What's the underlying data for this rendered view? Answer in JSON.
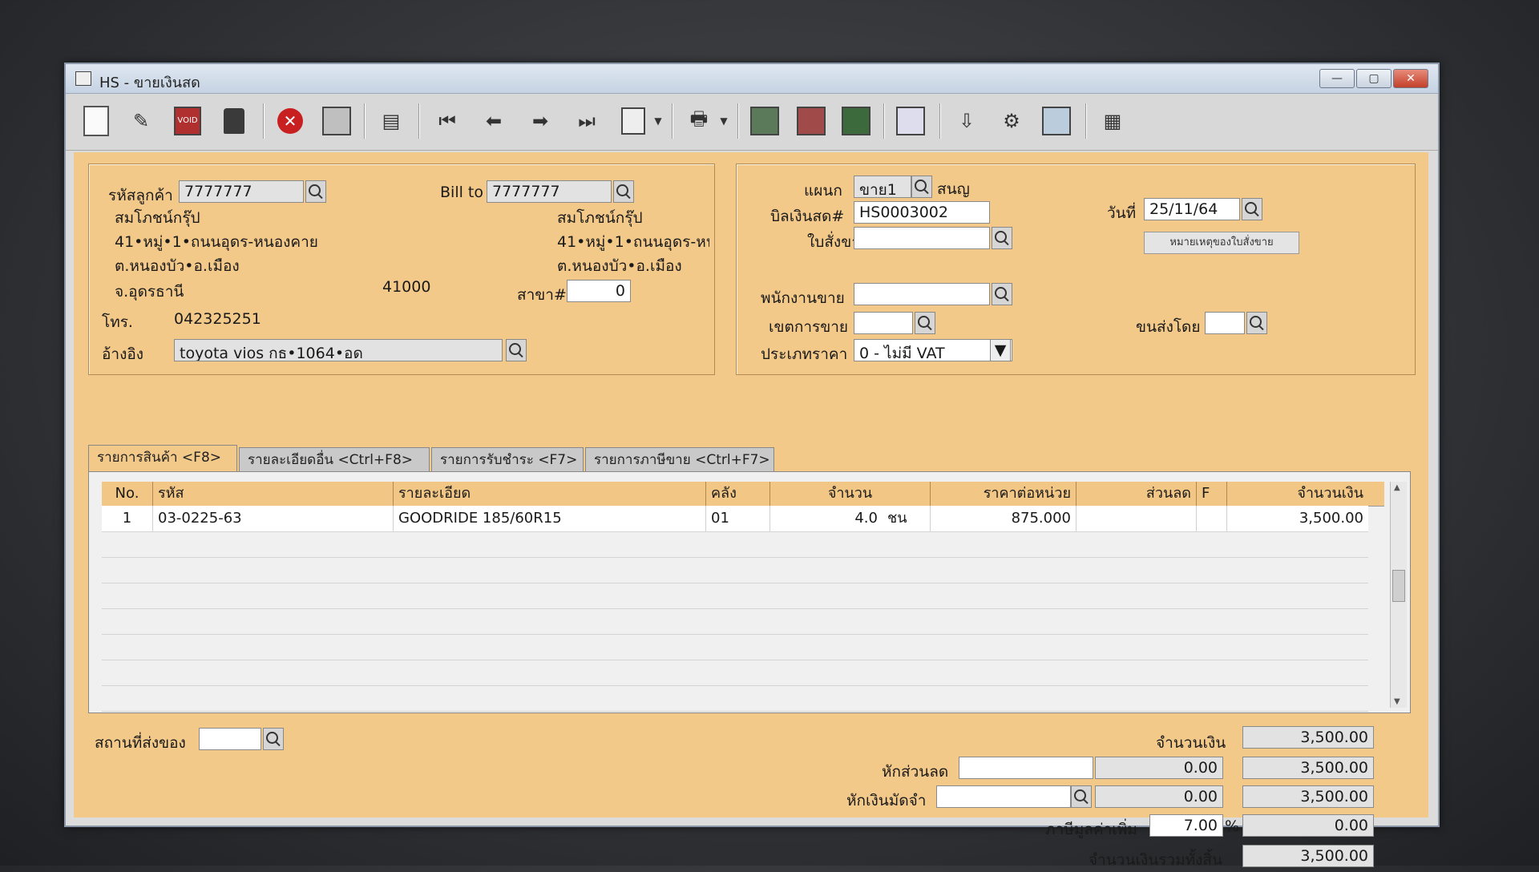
{
  "window": {
    "title": "HS - ขายเงินสด"
  },
  "customer": {
    "code_label": "รหัสลูกค้า",
    "code": "7777777",
    "bill_to_label": "Bill to",
    "bill_to": "7777777",
    "name": "สมโภชน์กรุ๊ป",
    "address1": "41•หมู่•1•ถนนอุดร-หนองคาย",
    "address2": "ต.หนองบัว•อ.เมือง",
    "province": "จ.อุดรธานี",
    "postcode": "41000",
    "billto_name": "สมโภชน์กรุ๊ป",
    "billto_address1": "41•หมู่•1•ถนนอุดร-หนเ",
    "billto_address2": "ต.หนองบัว•อ.เมือง",
    "branch_label": "สาขา#",
    "branch": "0",
    "phone_label": "โทร.",
    "phone": "042325251",
    "reference_label": "อ้างอิง",
    "reference": "toyota vios กธ•1064•อด"
  },
  "doc": {
    "dept_label": "แผนก",
    "dept": "ขาย1",
    "dept_name": "สนญ",
    "bill_label": "บิลเงินสด#",
    "bill": "HS0003002",
    "order_label": "ใบสั่งขาย",
    "order": "",
    "date_label": "วันที่",
    "date": "25/11/64",
    "note_button": "หมายเหตุของใบสั่งขาย",
    "salesman_label": "พนักงานขาย",
    "salesman": "",
    "area_label": "เขตการขาย",
    "area": "",
    "ship_by_label": "ขนส่งโดย",
    "ship_by": "",
    "price_type_label": "ประเภทราคา",
    "price_type": "0 - ไม่มี VAT"
  },
  "tabs": [
    {
      "label": "รายการสินค้า <F8>"
    },
    {
      "label": "รายละเอียดอื่น <Ctrl+F8>"
    },
    {
      "label": "รายการรับชำระ <F7>"
    },
    {
      "label": "รายการภาษีขาย <Ctrl+F7>"
    }
  ],
  "grid": {
    "headers": {
      "no": "No.",
      "code": "รหัส",
      "desc": "รายละเอียด",
      "wh": "คลัง",
      "qty": "จำนวน",
      "price": "ราคาต่อหน่วย",
      "disc": "ส่วนลด",
      "f": "F",
      "amount": "จำนวนเงิน"
    },
    "rows": [
      {
        "no": "1",
        "code": "03-0225-63",
        "desc": "GOODRIDE 185/60R15",
        "wh": "01",
        "qty": "4.0",
        "unit": "ชน",
        "price": "875.000",
        "disc": "",
        "f": "",
        "amount": "3,500.00"
      }
    ]
  },
  "footer": {
    "ship_place_label": "สถานที่ส่งของ",
    "ship_place": "",
    "amount_label": "จำนวนเงิน",
    "amount": "3,500.00",
    "discount_label": "หักส่วนลด",
    "discount_input": "",
    "discount_value": "0.00",
    "after_discount": "3,500.00",
    "deposit_label": "หักเงินมัดจำ",
    "deposit_input": "",
    "deposit_value": "0.00",
    "after_deposit": "3,500.00",
    "vat_label": "ภาษีมูลค่าเพิ่ม",
    "vat_rate": "7.00",
    "vat_pct": "%",
    "vat_amount": "0.00",
    "total_label": "จำนวนเงินรวมทั้งสิ้น",
    "total": "3,500.00"
  }
}
